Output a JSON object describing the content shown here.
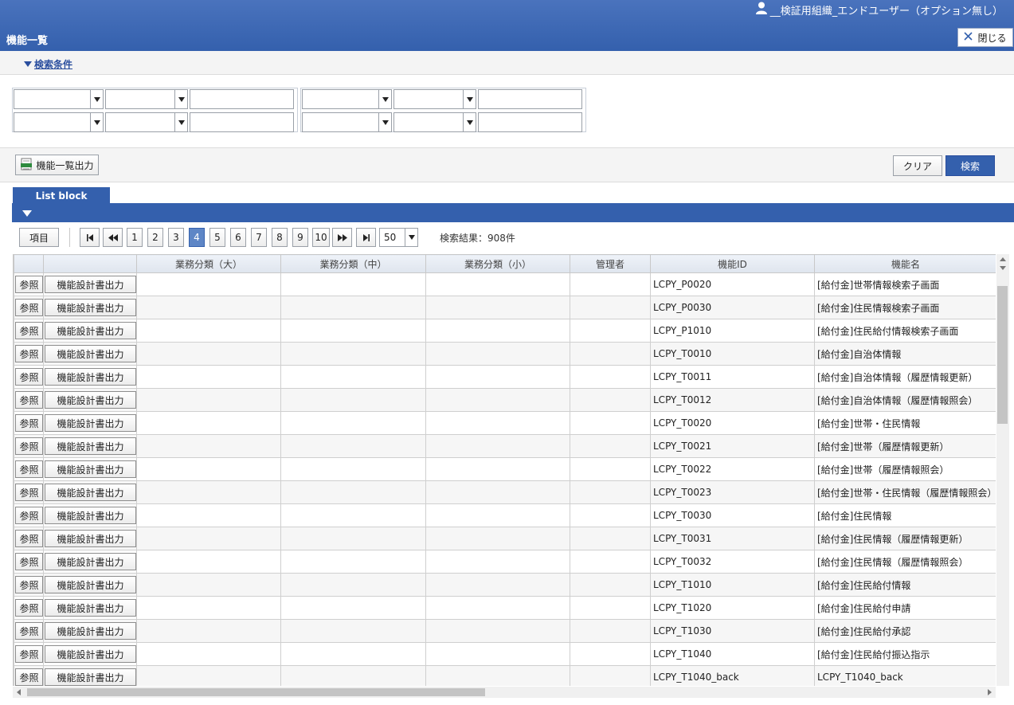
{
  "header": {
    "user_name": "__検証用組織_エンドユーザー（オプション無し）",
    "page_title": "機能一覧",
    "close_label": "閉じる"
  },
  "conditions": {
    "toggle_label": "検索条件"
  },
  "actions": {
    "export_label": "機能一覧出力",
    "clear_label": "クリア",
    "search_label": "検索"
  },
  "list": {
    "tab_label": "List block",
    "items_button": "項目",
    "pages": [
      "1",
      "2",
      "3",
      "4",
      "5",
      "6",
      "7",
      "8",
      "9",
      "10"
    ],
    "current_page": "4",
    "page_size": "50",
    "result_count": "検索結果：908件"
  },
  "table": {
    "headers": [
      "",
      "",
      "業務分類（大）",
      "業務分類（中）",
      "業務分類（小）",
      "管理者",
      "機能ID",
      "機能名"
    ],
    "ref_label": "参照",
    "design_label": "機能設計書出力",
    "rows": [
      {
        "id": "LCPY_P0020",
        "name": "[給付金]世帯情報検索子画面"
      },
      {
        "id": "LCPY_P0030",
        "name": "[給付金]住民情報検索子画面"
      },
      {
        "id": "LCPY_P1010",
        "name": "[給付金]住民給付情報検索子画面"
      },
      {
        "id": "LCPY_T0010",
        "name": "[給付金]自治体情報"
      },
      {
        "id": "LCPY_T0011",
        "name": "[給付金]自治体情報（履歴情報更新）"
      },
      {
        "id": "LCPY_T0012",
        "name": "[給付金]自治体情報（履歴情報照会）"
      },
      {
        "id": "LCPY_T0020",
        "name": "[給付金]世帯・住民情報"
      },
      {
        "id": "LCPY_T0021",
        "name": "[給付金]世帯（履歴情報更新）"
      },
      {
        "id": "LCPY_T0022",
        "name": "[給付金]世帯（履歴情報照会）"
      },
      {
        "id": "LCPY_T0023",
        "name": "[給付金]世帯・住民情報（履歴情報照会）"
      },
      {
        "id": "LCPY_T0030",
        "name": "[給付金]住民情報"
      },
      {
        "id": "LCPY_T0031",
        "name": "[給付金]住民情報（履歴情報更新）"
      },
      {
        "id": "LCPY_T0032",
        "name": "[給付金]住民情報（履歴情報照会）"
      },
      {
        "id": "LCPY_T1010",
        "name": "[給付金]住民給付情報"
      },
      {
        "id": "LCPY_T1020",
        "name": "[給付金]住民給付申請"
      },
      {
        "id": "LCPY_T1030",
        "name": "[給付金]住民給付承認"
      },
      {
        "id": "LCPY_T1040",
        "name": "[給付金]住民給付振込指示"
      },
      {
        "id": "LCPY_T1040_back",
        "name": "LCPY_T1040_back"
      }
    ]
  },
  "colors": {
    "primary": "#3460ad",
    "header_top": "#4a73bd",
    "link": "#2a4e9e"
  }
}
